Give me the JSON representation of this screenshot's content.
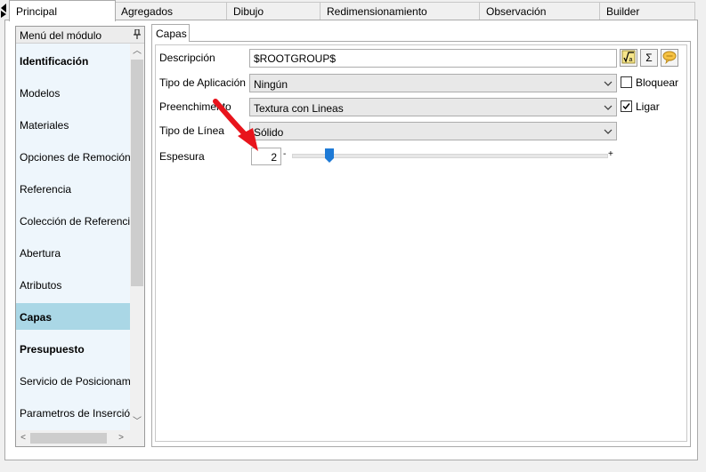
{
  "tabs": [
    "Principal",
    "Agregados",
    "Dibujo",
    "Redimensionamiento",
    "Observación",
    "Builder"
  ],
  "active_tab": "Principal",
  "menu": {
    "title": "Menú del módulo",
    "pin_icon": "pin-icon",
    "items": [
      {
        "label": "Identificación",
        "bold": true
      },
      {
        "label": "Modelos",
        "bold": false
      },
      {
        "label": "Materiales",
        "bold": false
      },
      {
        "label": "Opciones de Remoción",
        "bold": false
      },
      {
        "label": "Referencia",
        "bold": false
      },
      {
        "label": "Colección de Referencias",
        "bold": false
      },
      {
        "label": "Abertura",
        "bold": false
      },
      {
        "label": "Atributos",
        "bold": false
      },
      {
        "label": "Capas",
        "bold": true,
        "selected": true
      },
      {
        "label": "Presupuesto",
        "bold": true
      },
      {
        "label": "Servicio de Posicionamiento",
        "bold": false
      },
      {
        "label": "Parametros de Inserción",
        "bold": false
      }
    ]
  },
  "panel": {
    "tab": "Capas",
    "descripcion_label": "Descripción",
    "descripcion_value": "$ROOTGROUP$",
    "tipo_aplicacion_label": "Tipo de Aplicación",
    "tipo_aplicacion_value": "Ningún",
    "preenchimento_label": "Preenchimento",
    "preenchimento_value": "Textura con Lineas",
    "tipo_linea_label": "Tipo de Línea",
    "tipo_linea_value": "Sólido",
    "espesura_label": "Espesura",
    "espesura_value": "2",
    "slider_min_label": "-",
    "slider_max_label": "+",
    "slider_level": 0.12,
    "bloquear_label": "Bloquear",
    "bloquear_checked": false,
    "ligar_label": "Ligar",
    "ligar_checked": true,
    "formula_icon": "square-root-icon",
    "sum_icon": "sigma-icon",
    "comment_icon": "speech-bubble-icon",
    "sum_glyph": "Σ"
  },
  "colors": {
    "selected_item": "#aad7e6",
    "menu_background": "#eef6fc",
    "slider_thumb": "#1e7ad6",
    "annotation_arrow": "#e8141c"
  }
}
